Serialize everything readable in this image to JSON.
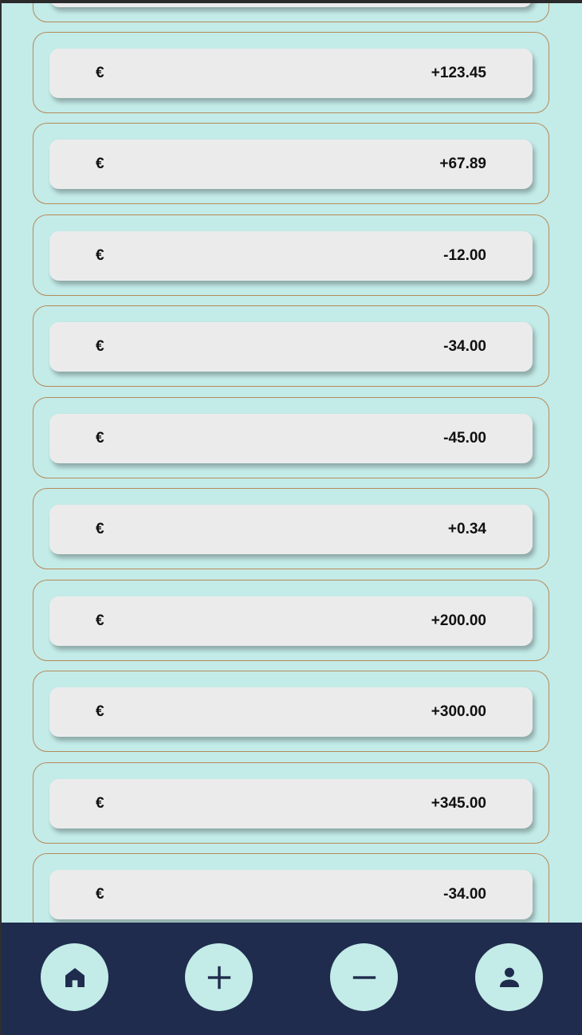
{
  "transactions": [
    {
      "currency": "€",
      "amount": ""
    },
    {
      "currency": "€",
      "amount": "+123.45"
    },
    {
      "currency": "€",
      "amount": "+67.89"
    },
    {
      "currency": "€",
      "amount": "-12.00"
    },
    {
      "currency": "€",
      "amount": "-34.00"
    },
    {
      "currency": "€",
      "amount": "-45.00"
    },
    {
      "currency": "€",
      "amount": "+0.34"
    },
    {
      "currency": "€",
      "amount": "+200.00"
    },
    {
      "currency": "€",
      "amount": "+300.00"
    },
    {
      "currency": "€",
      "amount": "+345.00"
    },
    {
      "currency": "€",
      "amount": "-34.00"
    }
  ],
  "nav": {
    "items": [
      {
        "icon": "home-icon"
      },
      {
        "icon": "plus-icon"
      },
      {
        "icon": "minus-icon"
      },
      {
        "icon": "person-icon"
      }
    ]
  },
  "colors": {
    "background": "#c3ebe8",
    "row_border": "#b58a56",
    "card": "#ecebec",
    "nav_bar": "#1f2c4d",
    "icon": "#1f2c4d"
  }
}
